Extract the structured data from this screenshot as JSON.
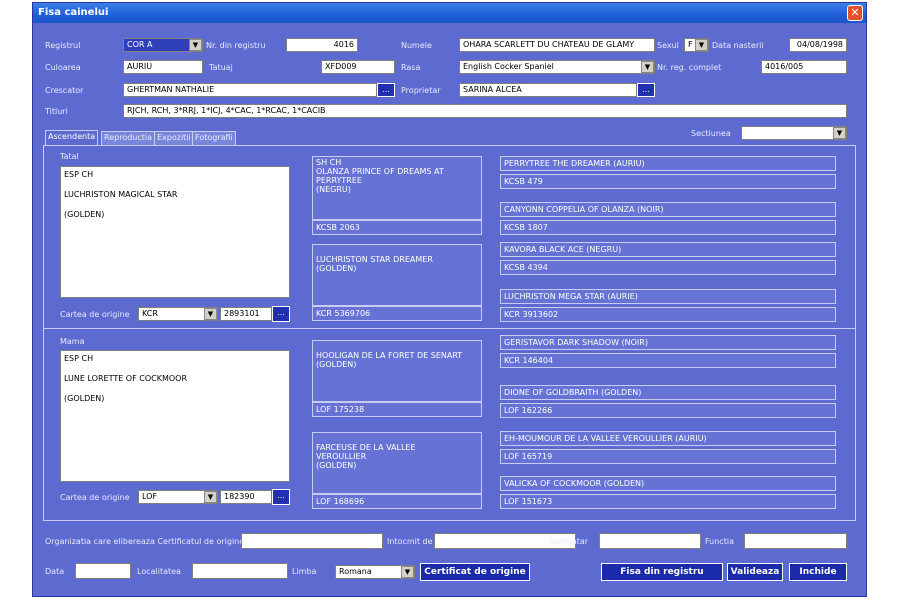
{
  "window": {
    "title": "Fisa cainelui",
    "close": "✕"
  },
  "form": {
    "registrul_label": "Registrul",
    "registrul_value": "COR A",
    "nr_registru_label": "Nr. din registru",
    "nr_registru_value": "4016",
    "numele_label": "Numele",
    "numele_value": "OHARA SCARLETT DU CHATEAU DE GLAMY",
    "sexul_label": "Sexul",
    "sexul_value": "F",
    "data_nasterii_label": "Data nasterii",
    "data_nasterii_value": "04/08/1998",
    "culoarea_label": "Culoarea",
    "culoarea_value": "AURIU",
    "tatuaj_label": "Tatuaj",
    "tatuaj_value": "XFD009",
    "rasa_label": "Rasa",
    "rasa_value": "English Cocker Spaniel",
    "nr_reg_complet_label": "Nr. reg. complet",
    "nr_reg_complet_value": "4016/005",
    "crescator_label": "Crescator",
    "crescator_value": "GHERTMAN NATHALIE",
    "proprietar_label": "Proprietar",
    "proprietar_value": "SARINA ALCEA",
    "titluri_label": "Titluri",
    "titluri_value": "RJCH, RCH, 3*RRJ, 1*ICJ, 4*CAC, 1*RCAC, 1*CACIB",
    "browse": "..."
  },
  "tabs": [
    {
      "label": "Ascendenta"
    },
    {
      "label": "Reproductia"
    },
    {
      "label": "Expozitii"
    },
    {
      "label": "Fotografii"
    }
  ],
  "sectiunea_label": "Sectiunea",
  "tatal": {
    "label": "Tatal",
    "lines": [
      "ESP CH",
      "LUCHRISTON MAGICAL STAR",
      "(GOLDEN)"
    ],
    "cartea_label": "Cartea de origine",
    "cartea_value": "KCR",
    "cartea_nr": "2893101"
  },
  "mama": {
    "label": "Mama",
    "lines": [
      "ESP CH",
      "LUNE LORETTE OF COCKMOOR",
      "(GOLDEN)"
    ],
    "cartea_label": "Cartea de origine",
    "cartea_value": "LOF",
    "cartea_nr": "182390"
  },
  "gen2": [
    {
      "name": "SH CH\nOLANZA PRINCE OF DREAMS AT PERRYTREE\n(NEGRU)",
      "reg": "KCSB 2063"
    },
    {
      "name": "LUCHRISTON STAR DREAMER\n(GOLDEN)",
      "reg": "KCR 5369706"
    },
    {
      "name": "HOOLIGAN DE LA FORET DE SENART\n(GOLDEN)",
      "reg": "LOF 175238"
    },
    {
      "name": "FARCEUSE DE LA VALLEE\nVEROULLIER\n(GOLDEN)",
      "reg": "LOF 168696"
    }
  ],
  "gen3": [
    {
      "name": "PERRYTREE THE DREAMER (AURIU)",
      "reg": "KCSB 479"
    },
    {
      "name": "CANYONN COPPELIA OF OLANZA (NOIR)",
      "reg": "KCSB 1807"
    },
    {
      "name": "KAVORA BLACK ACE (NEGRU)",
      "reg": "KCSB 4394"
    },
    {
      "name": "LUCHRISTON MEGA STAR (AURIE)",
      "reg": "KCR 3913602"
    },
    {
      "name": "GERISTAVOR DARK SHADOW (NOIR)",
      "reg": "KCR 146404"
    },
    {
      "name": "DIONE OF GOLDBRAITH (GOLDEN)",
      "reg": "LOF 162266"
    },
    {
      "name": "EH-MOUMOUR DE LA VALLEE VEROULLIER (AURIU)",
      "reg": "LOF 165719"
    },
    {
      "name": "VALICKA OF COCKMOOR (GOLDEN)",
      "reg": "LOF 151673"
    }
  ],
  "footer": {
    "org_label": "Organizatia care elibereaza Certificatul de origine",
    "intocmit_label": "Intocmit de",
    "semnatar_label": "Semnatar",
    "functia_label": "Functia",
    "data_label": "Data",
    "localitatea_label": "Localitatea",
    "limba_label": "Limba",
    "limba_value": "Romana",
    "certificat_btn": "Certificat de origine",
    "fisa_btn": "Fisa din registru",
    "valideaza_btn": "Valideaza",
    "inchide_btn": "Inchide"
  }
}
